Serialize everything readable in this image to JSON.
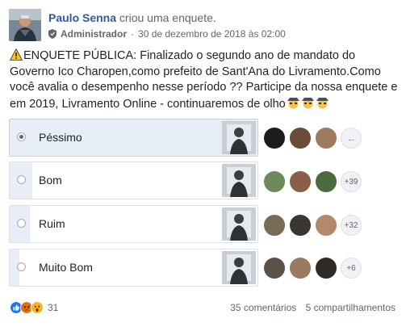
{
  "post": {
    "author": "Paulo Senna",
    "action": "criou uma enquete.",
    "role": "Administrador",
    "separator": "·",
    "date": "30 de dezembro de 2018 às 02:00",
    "text": "ENQUETE PÚBLICA: Finalizado o segundo ano de mandato do Governo Ico Charopen,como prefeito de Sant'Ana do Livramento.Como você avalia o desempenho nesse período ?? Participe da nossa enquete e em 2019, Livramento Online - continuaremos de olho",
    "prefix_icon": "warning-icon",
    "suffix_icons": [
      "spy-emoji-icon",
      "spy-emoji-icon",
      "spy-emoji-icon"
    ]
  },
  "poll": {
    "options": [
      {
        "label": "Péssimo",
        "selected": true,
        "fill_fraction": 1.0,
        "more": "..."
      },
      {
        "label": "Bom",
        "selected": false,
        "fill_fraction": 0.09,
        "more": "+39"
      },
      {
        "label": "Ruim",
        "selected": false,
        "fill_fraction": 0.08,
        "more": "+32"
      },
      {
        "label": "Muito Bom",
        "selected": false,
        "fill_fraction": 0.04,
        "more": "+6"
      }
    ]
  },
  "footer": {
    "reactions": [
      "like-icon",
      "angry-icon",
      "wow-icon"
    ],
    "reaction_count": "31",
    "comments": "35 comentários",
    "shares": "5 compartilhamentos"
  },
  "colors": {
    "link": "#365899",
    "muted": "#606770",
    "like": "#1877f2",
    "angry": "#e9710f",
    "wow": "#f7b125"
  }
}
